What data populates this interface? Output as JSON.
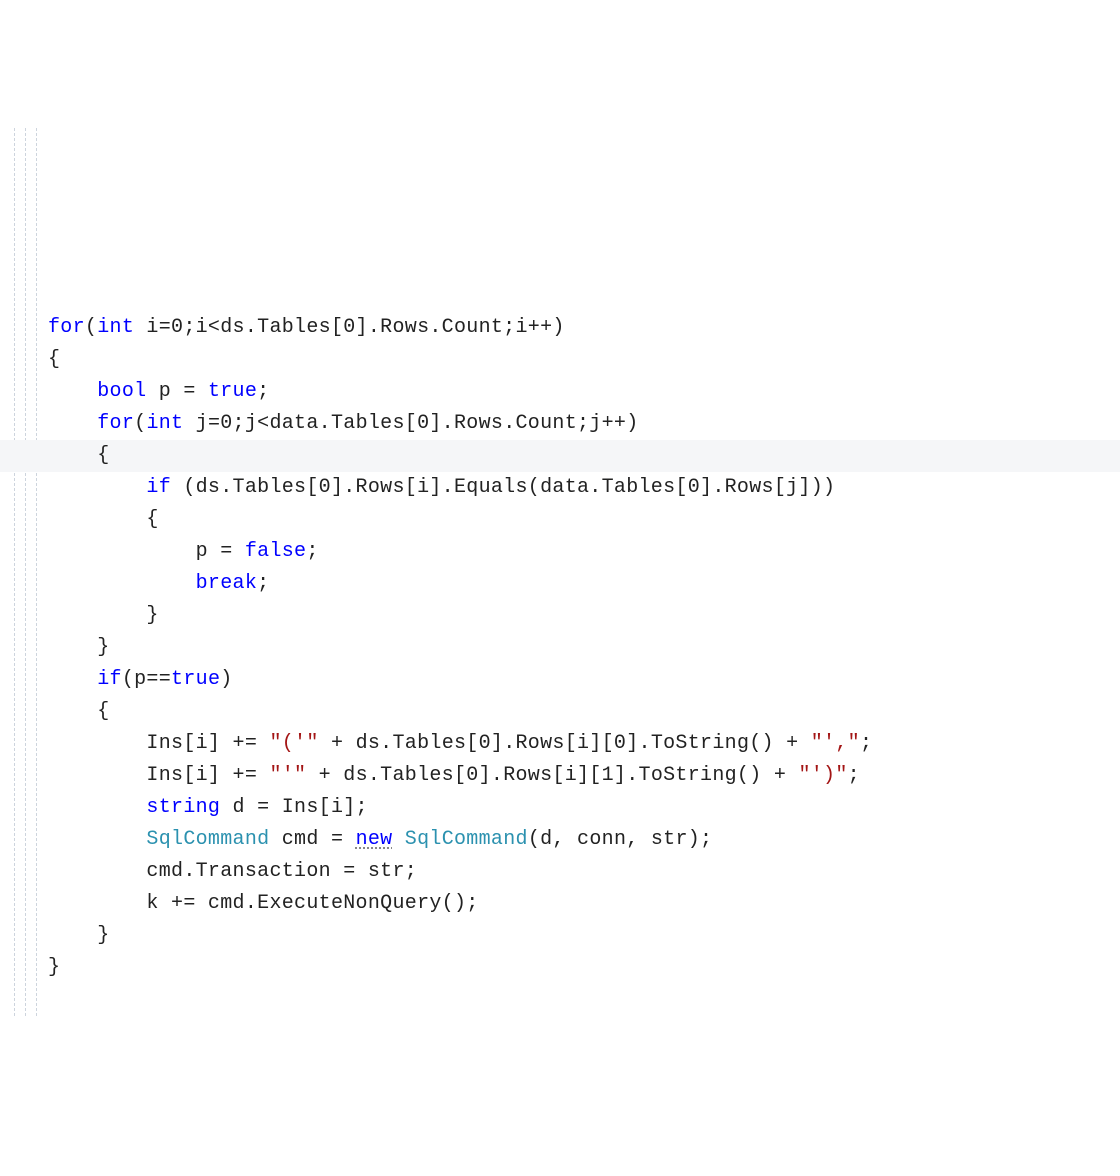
{
  "code": {
    "lines": [
      {
        "indent": 0,
        "hl": false,
        "segments": [
          {
            "t": "for",
            "c": "kw"
          },
          {
            "t": "(",
            "c": "txt"
          },
          {
            "t": "int",
            "c": "kw"
          },
          {
            "t": " i=0;i<ds.Tables[0].Rows.Count;i++)",
            "c": "txt"
          }
        ]
      },
      {
        "indent": 0,
        "hl": false,
        "segments": [
          {
            "t": "{",
            "c": "txt"
          }
        ]
      },
      {
        "indent": 1,
        "hl": false,
        "segments": [
          {
            "t": "bool",
            "c": "kw"
          },
          {
            "t": " p = ",
            "c": "txt"
          },
          {
            "t": "true",
            "c": "kw"
          },
          {
            "t": ";",
            "c": "txt"
          }
        ]
      },
      {
        "indent": 1,
        "hl": false,
        "segments": [
          {
            "t": "for",
            "c": "kw"
          },
          {
            "t": "(",
            "c": "txt"
          },
          {
            "t": "int",
            "c": "kw"
          },
          {
            "t": " j=0;j<data.Tables[0].Rows.Count;j++)",
            "c": "txt"
          }
        ]
      },
      {
        "indent": 1,
        "hl": true,
        "segments": [
          {
            "t": "{",
            "c": "txt"
          }
        ]
      },
      {
        "indent": 2,
        "hl": false,
        "segments": [
          {
            "t": "if",
            "c": "kw"
          },
          {
            "t": " (ds.Tables[0].Rows[i].Equals(data.Tables[0].Rows[j]))",
            "c": "txt"
          }
        ]
      },
      {
        "indent": 2,
        "hl": false,
        "segments": [
          {
            "t": "{",
            "c": "txt"
          }
        ]
      },
      {
        "indent": 3,
        "hl": false,
        "segments": [
          {
            "t": "p = ",
            "c": "txt"
          },
          {
            "t": "false",
            "c": "kw"
          },
          {
            "t": ";",
            "c": "txt"
          }
        ]
      },
      {
        "indent": 3,
        "hl": false,
        "segments": [
          {
            "t": "break",
            "c": "kw"
          },
          {
            "t": ";",
            "c": "txt"
          }
        ]
      },
      {
        "indent": 2,
        "hl": false,
        "segments": [
          {
            "t": "}",
            "c": "txt"
          }
        ]
      },
      {
        "indent": 1,
        "hl": false,
        "segments": [
          {
            "t": "}",
            "c": "txt"
          }
        ]
      },
      {
        "indent": 1,
        "hl": false,
        "segments": [
          {
            "t": "if",
            "c": "kw"
          },
          {
            "t": "(p==",
            "c": "txt"
          },
          {
            "t": "true",
            "c": "kw"
          },
          {
            "t": ")",
            "c": "txt"
          }
        ]
      },
      {
        "indent": 1,
        "hl": false,
        "segments": [
          {
            "t": "{",
            "c": "txt"
          }
        ]
      },
      {
        "indent": 2,
        "hl": false,
        "segments": [
          {
            "t": "Ins[i] += ",
            "c": "txt"
          },
          {
            "t": "\"('\"",
            "c": "str"
          },
          {
            "t": " + ds.Tables[0].Rows[i][0].ToString() + ",
            "c": "txt"
          },
          {
            "t": "\"',\"",
            "c": "str"
          },
          {
            "t": ";",
            "c": "txt"
          }
        ]
      },
      {
        "indent": 2,
        "hl": false,
        "segments": [
          {
            "t": "Ins[i] += ",
            "c": "txt"
          },
          {
            "t": "\"'\"",
            "c": "str"
          },
          {
            "t": " + ds.Tables[0].Rows[i][1].ToString() + ",
            "c": "txt"
          },
          {
            "t": "\"')\"",
            "c": "str"
          },
          {
            "t": ";",
            "c": "txt"
          }
        ]
      },
      {
        "indent": 2,
        "hl": false,
        "segments": [
          {
            "t": "string",
            "c": "kw"
          },
          {
            "t": " d = Ins[i];",
            "c": "txt"
          }
        ]
      },
      {
        "indent": 2,
        "hl": false,
        "segments": [
          {
            "t": "SqlCommand",
            "c": "type"
          },
          {
            "t": " cmd = ",
            "c": "txt"
          },
          {
            "t": "new",
            "c": "kw",
            "sq": true
          },
          {
            "t": " ",
            "c": "txt"
          },
          {
            "t": "SqlCommand",
            "c": "type"
          },
          {
            "t": "(d, conn, str);",
            "c": "txt"
          }
        ]
      },
      {
        "indent": 2,
        "hl": false,
        "segments": [
          {
            "t": "cmd.Transaction = str;",
            "c": "txt"
          }
        ]
      },
      {
        "indent": 2,
        "hl": false,
        "segments": [
          {
            "t": "k += cmd.ExecuteNonQuery();",
            "c": "txt"
          }
        ]
      },
      {
        "indent": 1,
        "hl": false,
        "segments": [
          {
            "t": "}",
            "c": "txt"
          }
        ]
      },
      {
        "indent": 0,
        "hl": false,
        "segments": [
          {
            "t": "}",
            "c": "txt"
          }
        ]
      }
    ]
  }
}
